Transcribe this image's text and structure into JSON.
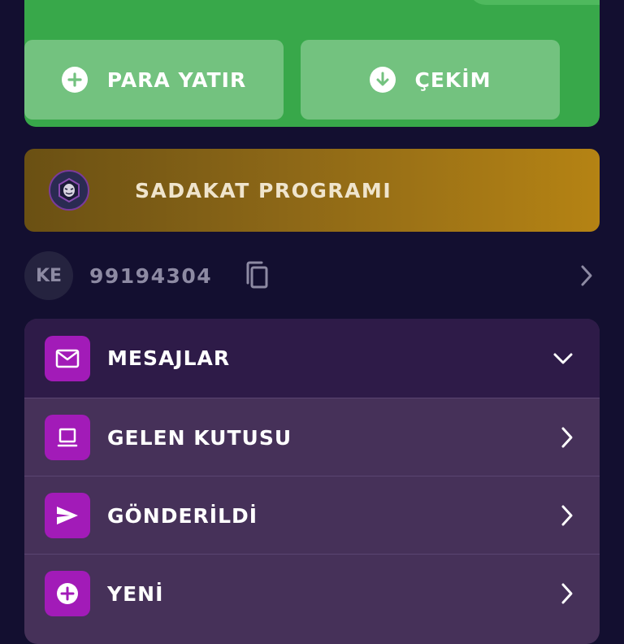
{
  "wallet": {
    "deposit_label": "PARA YATIR",
    "withdraw_label": "ÇEKİM"
  },
  "loyalty": {
    "label": "SADAKAT PROGRAMI"
  },
  "user": {
    "initials": "KE",
    "id": "99194304"
  },
  "messages": {
    "header_label": "MESAJLAR",
    "items": [
      {
        "label": "GELEN KUTUSU",
        "icon": "inbox-icon"
      },
      {
        "label": "GÖNDERİLDİ",
        "icon": "send-icon"
      },
      {
        "label": "YENİ",
        "icon": "plus-icon"
      }
    ]
  },
  "colors": {
    "background": "#130f30",
    "wallet_green": "#38a84a",
    "menu_accent": "#a21bb8",
    "loyalty_gold": "#b58314"
  }
}
